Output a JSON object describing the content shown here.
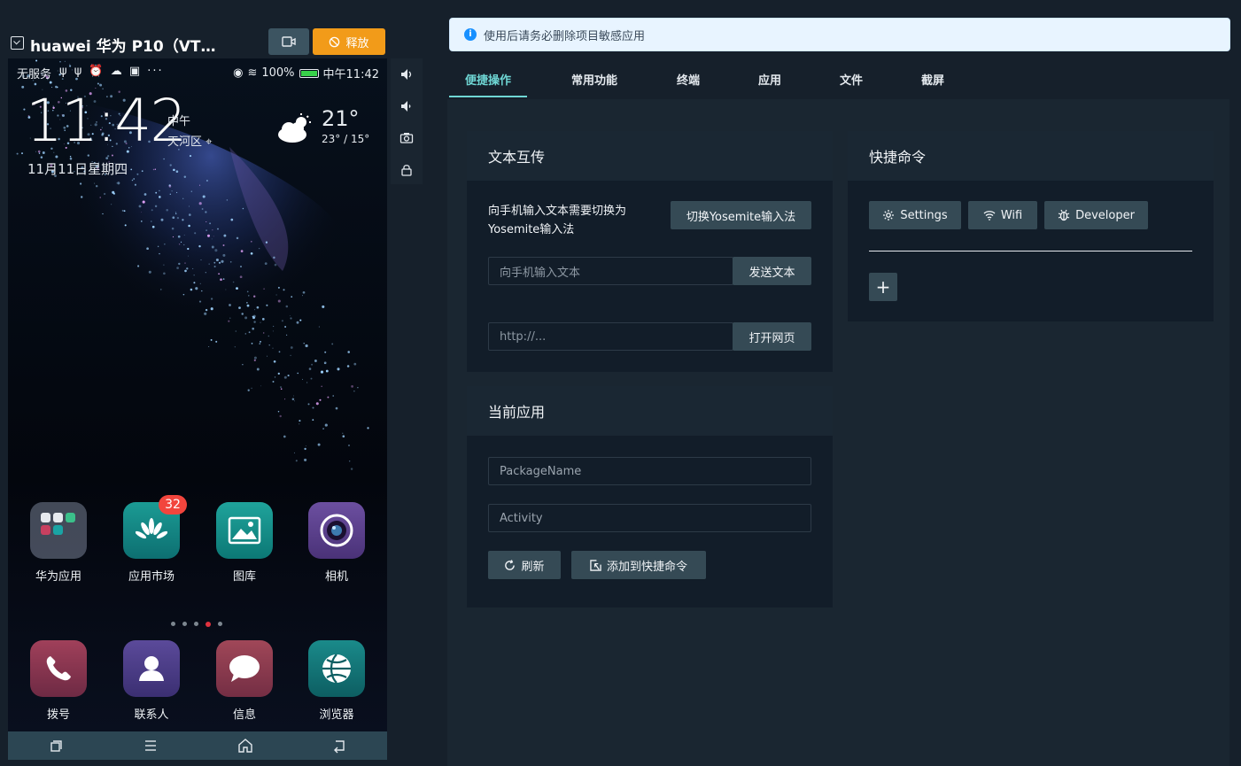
{
  "device": {
    "title": "huawei 华为 P10（VT…",
    "release_label": "释放"
  },
  "phone": {
    "carrier": "无服务",
    "status_icons_left": "ψ ψ ⏰ ☁ ▣ ···",
    "battery": "100%",
    "time_status": "中午11:42",
    "clock": "11:42",
    "ampm": "中午",
    "location": "天河区",
    "date": "11月11日星期四",
    "temperature": "21°",
    "temp_range": "23° / 15°",
    "apps_row1": [
      {
        "label": "华为应用",
        "icon": "folder-icon"
      },
      {
        "label": "应用市场",
        "icon": "appgallery-icon",
        "badge": "32"
      },
      {
        "label": "图库",
        "icon": "gallery-icon"
      },
      {
        "label": "相机",
        "icon": "camera-icon"
      }
    ],
    "apps_row2": [
      {
        "label": "拨号",
        "icon": "phone-icon"
      },
      {
        "label": "联系人",
        "icon": "contacts-icon"
      },
      {
        "label": "信息",
        "icon": "messages-icon"
      },
      {
        "label": "浏览器",
        "icon": "browser-icon"
      }
    ],
    "active_page": 4,
    "page_count": 5
  },
  "notice": "使用后请务必删除项目敏感应用",
  "tabs": [
    {
      "label": "便捷操作",
      "active": true
    },
    {
      "label": "常用功能"
    },
    {
      "label": "终端"
    },
    {
      "label": "应用"
    },
    {
      "label": "文件"
    },
    {
      "label": "截屏"
    }
  ],
  "text_transfer": {
    "title": "文本互传",
    "hint": "向手机输入文本需要切换为Yosemite输入法",
    "switch_ime_label": "切换Yosemite输入法",
    "text_placeholder": "向手机输入文本",
    "send_label": "发送文本",
    "url_placeholder": "http://...",
    "open_label": "打开网页"
  },
  "current_app": {
    "title": "当前应用",
    "package_placeholder": "PackageName",
    "activity_placeholder": "Activity",
    "refresh_label": "刷新",
    "add_shortcut_label": "添加到快捷命令"
  },
  "quick_commands": {
    "title": "快捷命令",
    "buttons": [
      {
        "label": "Settings",
        "icon": "gear-icon"
      },
      {
        "label": "Wifi",
        "icon": "wifi-icon"
      },
      {
        "label": "Developer",
        "icon": "bug-icon"
      }
    ],
    "add_label": "+"
  },
  "colors": {
    "accent": "#6fd7d5",
    "release": "#f29b19",
    "info": "#1890ff"
  }
}
